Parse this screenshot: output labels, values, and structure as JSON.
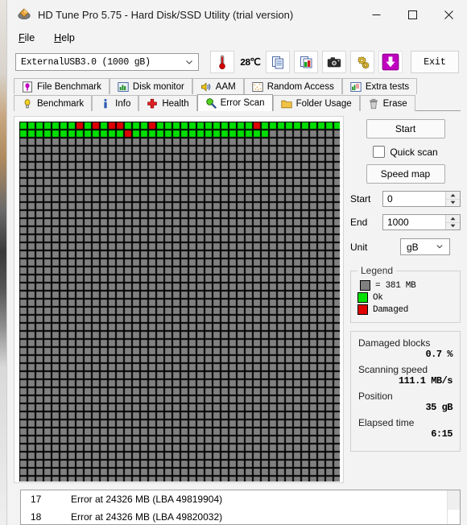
{
  "window": {
    "title": "HD Tune Pro 5.75 - Hard Disk/SSD Utility (trial version)",
    "icon": "hdtune-logo-icon",
    "minimize_label": "Minimize",
    "maximize_label": "Maximize",
    "close_label": "Close"
  },
  "menu": {
    "items": [
      {
        "label": "File",
        "accel": "F",
        "rest": "ile"
      },
      {
        "label": "Help",
        "accel": "H",
        "rest": "elp"
      }
    ]
  },
  "toolbar": {
    "drive": {
      "value": "ExternalUSB3.0  (1000 gB)",
      "icon": "chevron-down-icon"
    },
    "temperature": {
      "icon": "thermometer-icon",
      "value": "28℃"
    },
    "buttons": [
      {
        "name": "copy-button",
        "icon": "copy-document-icon"
      },
      {
        "name": "copy-image-button",
        "icon": "copy-image-icon"
      },
      {
        "name": "screenshot-button",
        "icon": "camera-icon"
      },
      {
        "name": "options-button",
        "icon": "gears-icon"
      },
      {
        "name": "save-button",
        "icon": "download-arrow-icon"
      }
    ],
    "exit_label": "Exit"
  },
  "tabs": {
    "top_row": [
      {
        "label": "File Benchmark",
        "icon": "file-benchmark-icon",
        "active": false
      },
      {
        "label": "Disk monitor",
        "icon": "disk-monitor-icon",
        "active": false
      },
      {
        "label": "AAM",
        "icon": "speaker-icon",
        "active": false
      },
      {
        "label": "Random Access",
        "icon": "random-access-icon",
        "active": false
      },
      {
        "label": "Extra tests",
        "icon": "extra-tests-icon",
        "active": false
      }
    ],
    "bottom_row": [
      {
        "label": "Benchmark",
        "icon": "lightbulb-icon",
        "active": false
      },
      {
        "label": "Info",
        "icon": "info-icon",
        "active": false
      },
      {
        "label": "Health",
        "icon": "red-cross-icon",
        "active": false
      },
      {
        "label": "Error Scan",
        "icon": "magnifier-icon",
        "active": true
      },
      {
        "label": "Folder Usage",
        "icon": "folder-icon",
        "active": false
      },
      {
        "label": "Erase",
        "icon": "trash-icon",
        "active": false
      }
    ]
  },
  "controls": {
    "start_label": "Start",
    "quick_scan_label": "Quick scan",
    "quick_scan_checked": false,
    "speed_map_label": "Speed map",
    "start_field": {
      "label": "Start",
      "value": "0"
    },
    "end_field": {
      "label": "End",
      "value": "1000"
    },
    "unit_field": {
      "label": "Unit",
      "value": "gB",
      "icon": "chevron-down-icon"
    }
  },
  "legend": {
    "title": "Legend",
    "block_size": "= 381 MB",
    "ok_label": "Ok",
    "damaged_label": "Damaged",
    "colors": {
      "unscanned": "#808080",
      "ok": "#00e000",
      "damaged": "#e00000",
      "grid": "#000000"
    }
  },
  "stats": [
    {
      "label": "Damaged blocks",
      "value": "0.7 %"
    },
    {
      "label": "Scanning speed",
      "value": "111.1 MB/s"
    },
    {
      "label": "Position",
      "value": "35 gB"
    },
    {
      "label": "Elapsed time",
      "value": "6:15"
    }
  ],
  "error_list": {
    "rows": [
      {
        "index": "17",
        "text": "Error at 24326 MB (LBA 49819904)"
      },
      {
        "index": "18",
        "text": "Error at 24326 MB (LBA 49820032)"
      }
    ]
  },
  "block_map": {
    "columns": 40,
    "rows": 45,
    "cell": 10,
    "scanned_cells": 71,
    "damaged_indices": [
      7,
      9,
      11,
      12,
      16,
      29,
      53
    ],
    "note": "row-major scan order; first row fully scanned, second row scanned through column 31"
  }
}
